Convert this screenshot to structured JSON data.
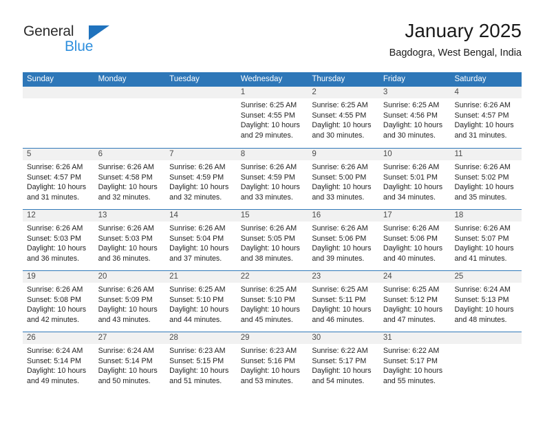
{
  "brand": {
    "name_top": "General",
    "name_bottom": "Blue",
    "triangle_color": "#1f72bd",
    "blue_text_color": "#2f8fdd"
  },
  "header": {
    "month_title": "January 2025",
    "location": "Bagdogra, West Bengal, India"
  },
  "theme": {
    "header_blue": "#2e77b8",
    "row_divider_blue": "#2e77b8",
    "day_band_gray": "#f1f1f1",
    "text_color": "#222222"
  },
  "weekdays": [
    "Sunday",
    "Monday",
    "Tuesday",
    "Wednesday",
    "Thursday",
    "Friday",
    "Saturday"
  ],
  "weeks": [
    [
      {
        "day": "",
        "lines": []
      },
      {
        "day": "",
        "lines": []
      },
      {
        "day": "",
        "lines": []
      },
      {
        "day": "1",
        "lines": [
          "Sunrise: 6:25 AM",
          "Sunset: 4:55 PM",
          "Daylight: 10 hours",
          "and 29 minutes."
        ]
      },
      {
        "day": "2",
        "lines": [
          "Sunrise: 6:25 AM",
          "Sunset: 4:55 PM",
          "Daylight: 10 hours",
          "and 30 minutes."
        ]
      },
      {
        "day": "3",
        "lines": [
          "Sunrise: 6:25 AM",
          "Sunset: 4:56 PM",
          "Daylight: 10 hours",
          "and 30 minutes."
        ]
      },
      {
        "day": "4",
        "lines": [
          "Sunrise: 6:26 AM",
          "Sunset: 4:57 PM",
          "Daylight: 10 hours",
          "and 31 minutes."
        ]
      }
    ],
    [
      {
        "day": "5",
        "lines": [
          "Sunrise: 6:26 AM",
          "Sunset: 4:57 PM",
          "Daylight: 10 hours",
          "and 31 minutes."
        ]
      },
      {
        "day": "6",
        "lines": [
          "Sunrise: 6:26 AM",
          "Sunset: 4:58 PM",
          "Daylight: 10 hours",
          "and 32 minutes."
        ]
      },
      {
        "day": "7",
        "lines": [
          "Sunrise: 6:26 AM",
          "Sunset: 4:59 PM",
          "Daylight: 10 hours",
          "and 32 minutes."
        ]
      },
      {
        "day": "8",
        "lines": [
          "Sunrise: 6:26 AM",
          "Sunset: 4:59 PM",
          "Daylight: 10 hours",
          "and 33 minutes."
        ]
      },
      {
        "day": "9",
        "lines": [
          "Sunrise: 6:26 AM",
          "Sunset: 5:00 PM",
          "Daylight: 10 hours",
          "and 33 minutes."
        ]
      },
      {
        "day": "10",
        "lines": [
          "Sunrise: 6:26 AM",
          "Sunset: 5:01 PM",
          "Daylight: 10 hours",
          "and 34 minutes."
        ]
      },
      {
        "day": "11",
        "lines": [
          "Sunrise: 6:26 AM",
          "Sunset: 5:02 PM",
          "Daylight: 10 hours",
          "and 35 minutes."
        ]
      }
    ],
    [
      {
        "day": "12",
        "lines": [
          "Sunrise: 6:26 AM",
          "Sunset: 5:03 PM",
          "Daylight: 10 hours",
          "and 36 minutes."
        ]
      },
      {
        "day": "13",
        "lines": [
          "Sunrise: 6:26 AM",
          "Sunset: 5:03 PM",
          "Daylight: 10 hours",
          "and 36 minutes."
        ]
      },
      {
        "day": "14",
        "lines": [
          "Sunrise: 6:26 AM",
          "Sunset: 5:04 PM",
          "Daylight: 10 hours",
          "and 37 minutes."
        ]
      },
      {
        "day": "15",
        "lines": [
          "Sunrise: 6:26 AM",
          "Sunset: 5:05 PM",
          "Daylight: 10 hours",
          "and 38 minutes."
        ]
      },
      {
        "day": "16",
        "lines": [
          "Sunrise: 6:26 AM",
          "Sunset: 5:06 PM",
          "Daylight: 10 hours",
          "and 39 minutes."
        ]
      },
      {
        "day": "17",
        "lines": [
          "Sunrise: 6:26 AM",
          "Sunset: 5:06 PM",
          "Daylight: 10 hours",
          "and 40 minutes."
        ]
      },
      {
        "day": "18",
        "lines": [
          "Sunrise: 6:26 AM",
          "Sunset: 5:07 PM",
          "Daylight: 10 hours",
          "and 41 minutes."
        ]
      }
    ],
    [
      {
        "day": "19",
        "lines": [
          "Sunrise: 6:26 AM",
          "Sunset: 5:08 PM",
          "Daylight: 10 hours",
          "and 42 minutes."
        ]
      },
      {
        "day": "20",
        "lines": [
          "Sunrise: 6:26 AM",
          "Sunset: 5:09 PM",
          "Daylight: 10 hours",
          "and 43 minutes."
        ]
      },
      {
        "day": "21",
        "lines": [
          "Sunrise: 6:25 AM",
          "Sunset: 5:10 PM",
          "Daylight: 10 hours",
          "and 44 minutes."
        ]
      },
      {
        "day": "22",
        "lines": [
          "Sunrise: 6:25 AM",
          "Sunset: 5:10 PM",
          "Daylight: 10 hours",
          "and 45 minutes."
        ]
      },
      {
        "day": "23",
        "lines": [
          "Sunrise: 6:25 AM",
          "Sunset: 5:11 PM",
          "Daylight: 10 hours",
          "and 46 minutes."
        ]
      },
      {
        "day": "24",
        "lines": [
          "Sunrise: 6:25 AM",
          "Sunset: 5:12 PM",
          "Daylight: 10 hours",
          "and 47 minutes."
        ]
      },
      {
        "day": "25",
        "lines": [
          "Sunrise: 6:24 AM",
          "Sunset: 5:13 PM",
          "Daylight: 10 hours",
          "and 48 minutes."
        ]
      }
    ],
    [
      {
        "day": "26",
        "lines": [
          "Sunrise: 6:24 AM",
          "Sunset: 5:14 PM",
          "Daylight: 10 hours",
          "and 49 minutes."
        ]
      },
      {
        "day": "27",
        "lines": [
          "Sunrise: 6:24 AM",
          "Sunset: 5:14 PM",
          "Daylight: 10 hours",
          "and 50 minutes."
        ]
      },
      {
        "day": "28",
        "lines": [
          "Sunrise: 6:23 AM",
          "Sunset: 5:15 PM",
          "Daylight: 10 hours",
          "and 51 minutes."
        ]
      },
      {
        "day": "29",
        "lines": [
          "Sunrise: 6:23 AM",
          "Sunset: 5:16 PM",
          "Daylight: 10 hours",
          "and 53 minutes."
        ]
      },
      {
        "day": "30",
        "lines": [
          "Sunrise: 6:22 AM",
          "Sunset: 5:17 PM",
          "Daylight: 10 hours",
          "and 54 minutes."
        ]
      },
      {
        "day": "31",
        "lines": [
          "Sunrise: 6:22 AM",
          "Sunset: 5:17 PM",
          "Daylight: 10 hours",
          "and 55 minutes."
        ]
      },
      {
        "day": "",
        "lines": []
      }
    ]
  ]
}
